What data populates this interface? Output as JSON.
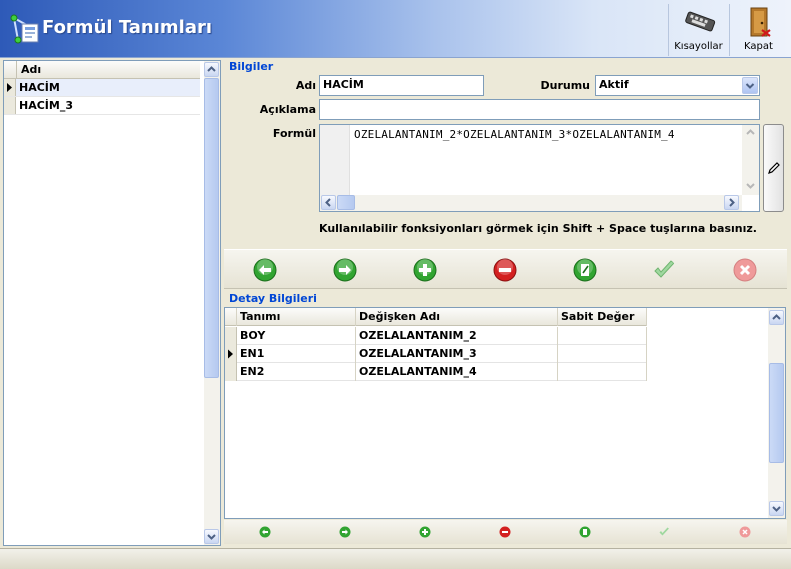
{
  "header": {
    "title": "Formül Tanımları",
    "buttons": [
      {
        "label": "Kısayollar",
        "icon": "keyboard-icon"
      },
      {
        "label": "Kapat",
        "icon": "exit-door-icon"
      }
    ]
  },
  "left_list": {
    "column": "Adı",
    "rows": [
      "HACİM",
      "HACİM_3"
    ],
    "selected_index": 0
  },
  "info": {
    "section_title": "Bilgiler",
    "name_label": "Adı",
    "name_value": "HACİM",
    "status_label": "Durumu",
    "status_value": "Aktif",
    "description_label": "Açıklama",
    "description_value": "",
    "formula_label": "Formül",
    "formula_value": "OZELALANTANIM_2*OZELALANTANIM_3*OZELALANTANIM_4",
    "hint": "Kullanılabilir fonksiyonları görmek için Shift + Space tuşlarına basınız."
  },
  "toolbar": [
    "back-arrow-icon",
    "forward-arrow-icon",
    "add-plus-icon",
    "delete-minus-icon",
    "edit-icon",
    "save-check-icon",
    "cancel-x-icon"
  ],
  "detail": {
    "section_title": "Detay Bilgileri",
    "columns": [
      "Tanımı",
      "Değişken Adı",
      "Sabit Değer"
    ],
    "rows": [
      [
        "BOY",
        "OZELALANTANIM_2",
        ""
      ],
      [
        "EN1",
        "OZELALANTANIM_3",
        ""
      ],
      [
        "EN2",
        "OZELALANTANIM_4",
        ""
      ]
    ],
    "current_row_index": 1
  },
  "colors": {
    "accent": "#0046d5",
    "green": "#2ea02e",
    "red": "#d32020"
  }
}
